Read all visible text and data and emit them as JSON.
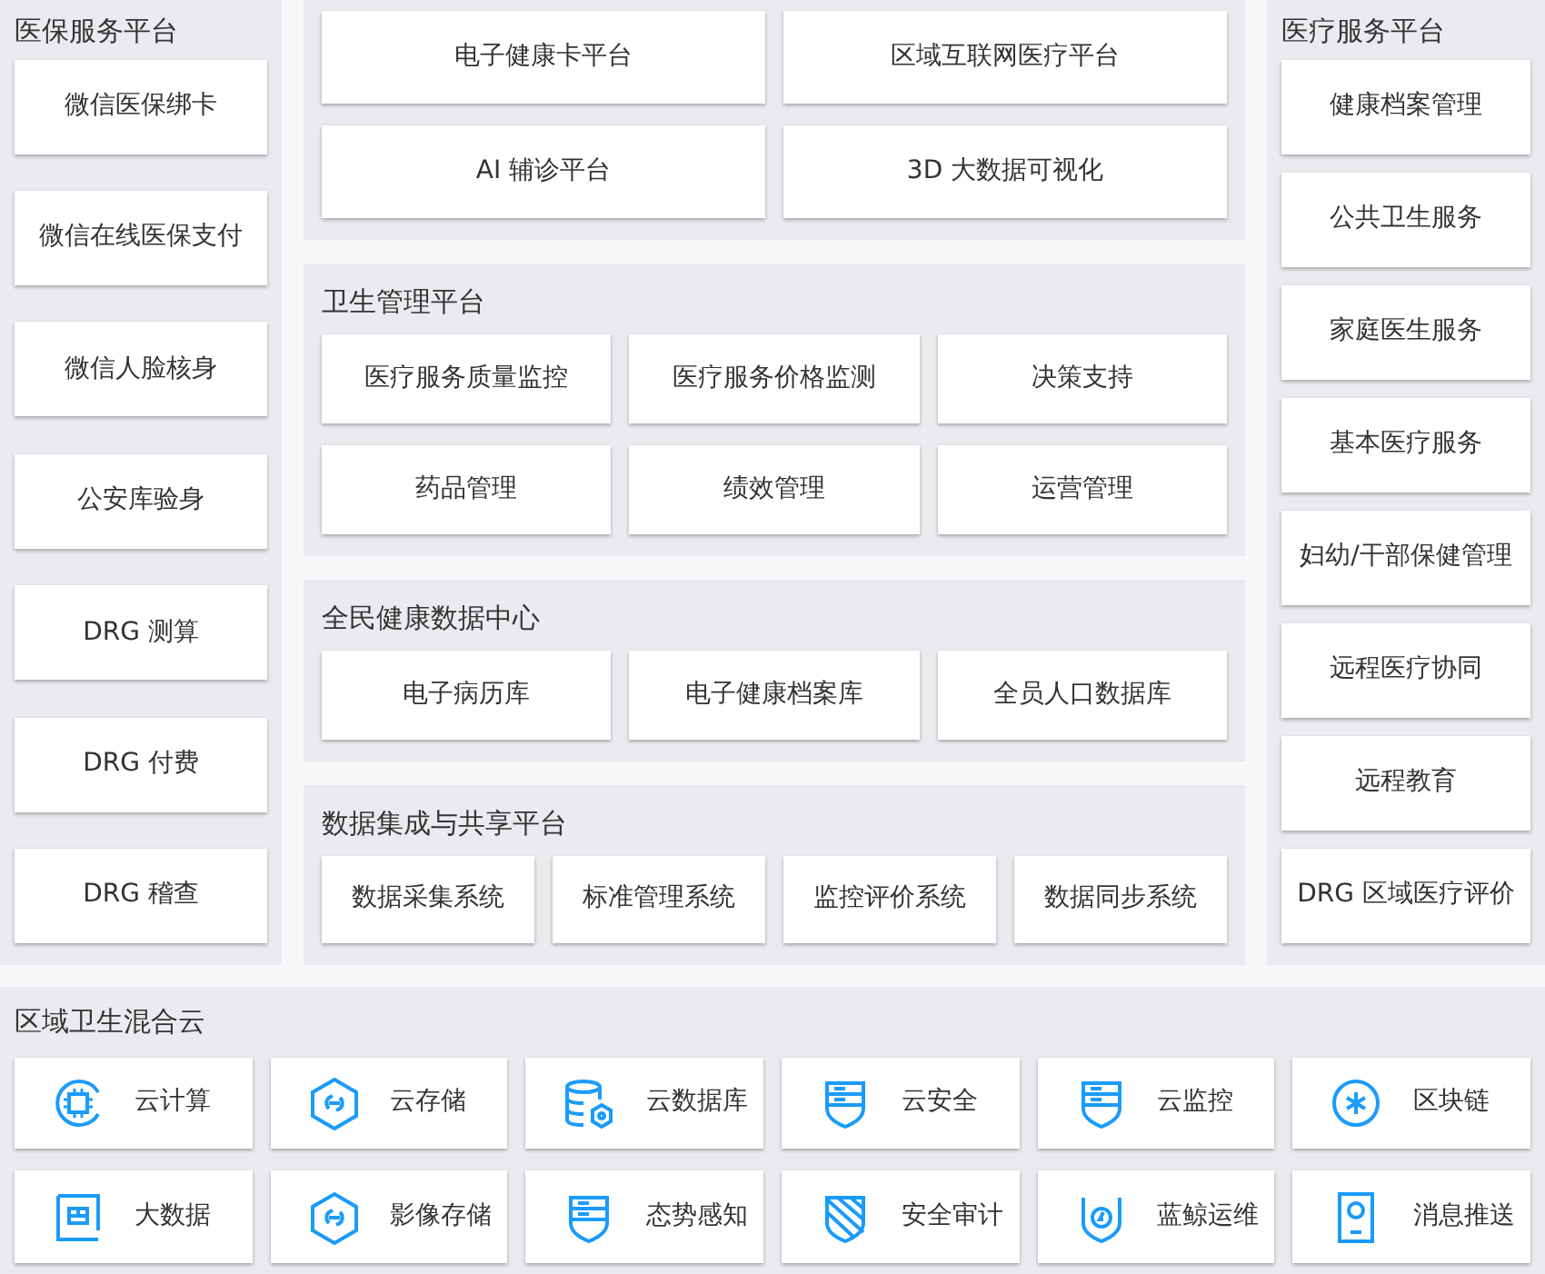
{
  "insurance_platform": {
    "title": "医保服务平台",
    "items": [
      "微信医保绑卡",
      "微信在线医保支付",
      "微信人脸核身",
      "公安库验身",
      "DRG 测算",
      "DRG 付费",
      "DRG 稽查"
    ]
  },
  "center_groups": [
    {
      "items": [
        "电子健康卡平台",
        "区域互联网医疗平台",
        "AI 辅诊平台",
        "3D 大数据可视化"
      ]
    },
    {
      "title": "卫生管理平台",
      "items": [
        "医疗服务质量监控",
        "医疗服务价格监测",
        "决策支持",
        "药品管理",
        "绩效管理",
        "运营管理"
      ]
    },
    {
      "title": "全民健康数据中心",
      "items": [
        "电子病历库",
        "电子健康档案库",
        "全员人口数据库"
      ]
    },
    {
      "title": "数据集成与共享平台",
      "items": [
        "数据采集系统",
        "标准管理系统",
        "监控评价系统",
        "数据同步系统"
      ]
    }
  ],
  "medical_platform": {
    "title": "医疗服务平台",
    "items": [
      "健康档案管理",
      "公共卫生服务",
      "家庭医生服务",
      "基本医疗服务",
      "妇幼/干部保健管理",
      "远程医疗协同",
      "远程教育",
      "DRG 区域医疗评价"
    ]
  },
  "hybrid_cloud": {
    "title": "区域卫生混合云",
    "items": [
      "云计算",
      "云存储",
      "云数据库",
      "云安全",
      "云监控",
      "区块链",
      "大数据",
      "影像存储",
      "态势感知",
      "安全审计",
      "蓝鲸运维",
      "消息推送"
    ]
  }
}
